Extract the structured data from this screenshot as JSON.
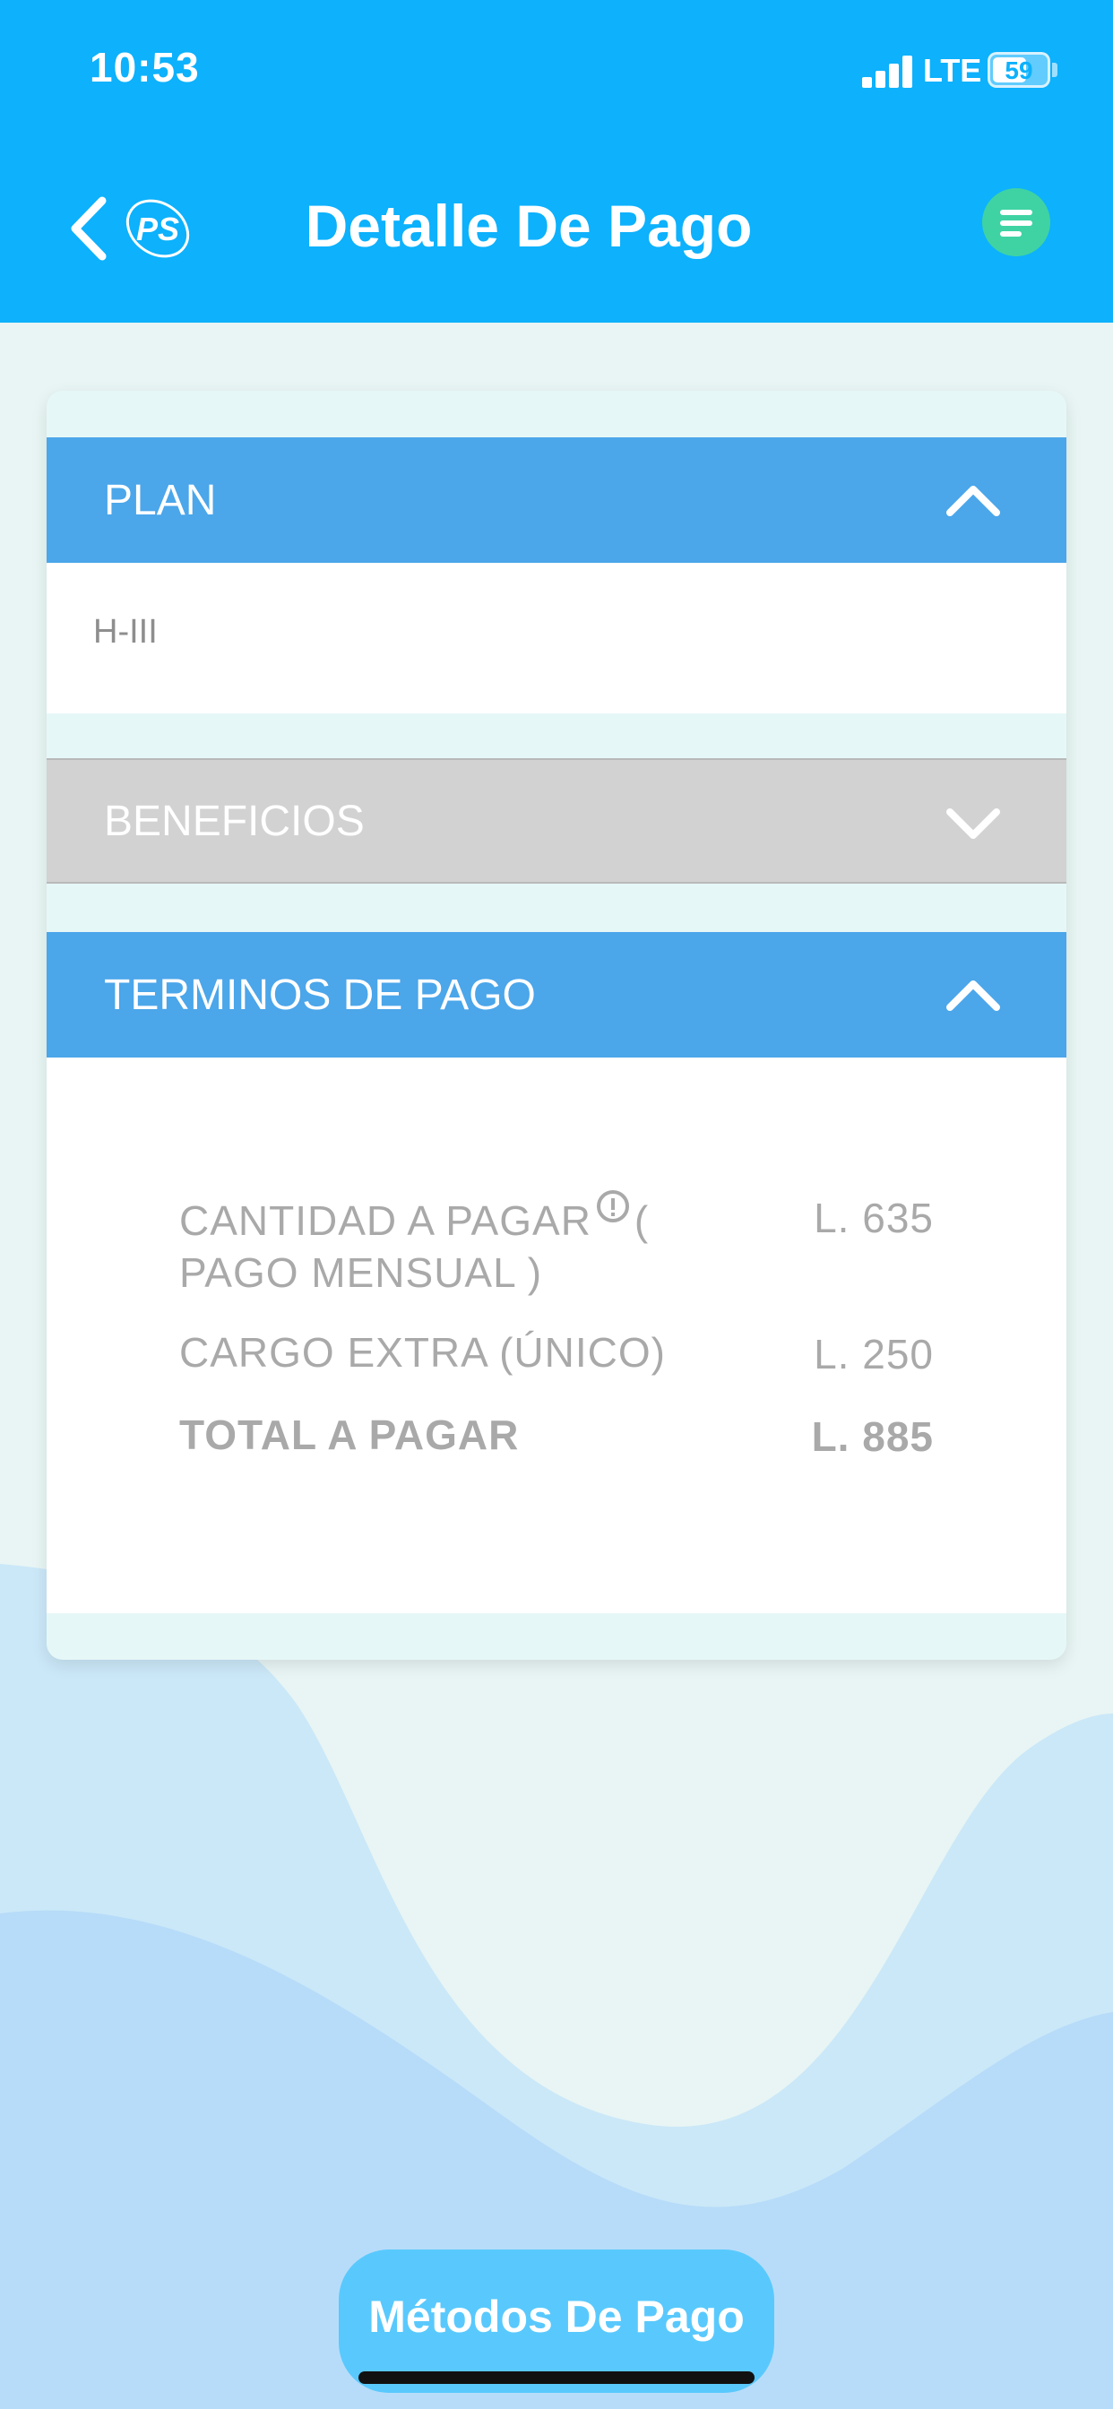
{
  "status_bar": {
    "time": "10:53",
    "network": "LTE",
    "battery": "59"
  },
  "header": {
    "title": "Detalle De Pago",
    "logo_text": "PS"
  },
  "sections": {
    "plan": {
      "label": "PLAN",
      "value": "H-III"
    },
    "beneficios": {
      "label": "BENEFICIOS"
    },
    "terminos": {
      "label": "TERMINOS DE PAGO"
    }
  },
  "payment_terms": {
    "monthly_label_1": "CANTIDAD A PAGAR",
    "monthly_label_2": "(",
    "monthly_label_3": "PAGO MENSUAL )",
    "monthly_value": "L. 635",
    "extra_label": "CARGO EXTRA (ÚNICO)",
    "extra_value": "L. 250",
    "total_label": "TOTAL A PAGAR",
    "total_value": "L. 885"
  },
  "footer": {
    "pay_methods_label": "Métodos De Pago"
  },
  "colors": {
    "header_bg": "#0db1fc",
    "section_blue": "#4ba6ea",
    "section_gray": "#d2d2d2",
    "menu_button": "#3fd3a3",
    "pay_button": "#59c9fd"
  }
}
